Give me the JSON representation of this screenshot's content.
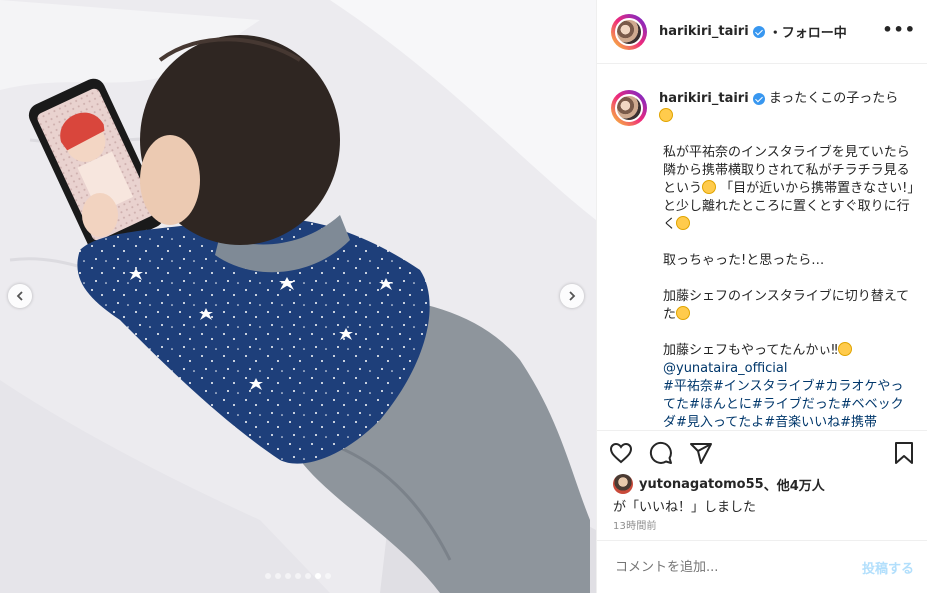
{
  "post": {
    "username": "harikiri_tairi",
    "follow_status": "・フォロー中",
    "more_label": "•••"
  },
  "caption": {
    "username": "harikiri_tairi",
    "first_line": "まったくこの子ったら",
    "paragraphs": [
      "私が平祐奈のインスタライブを見ていたら隣から携帯横取りされて私がチラチラ見るという",
      "「目が近いから携帯置きなさい!」と少し離れたところに置くとすぐ取りに行く",
      "取っちゃった!と思ったら…",
      "加藤シェフのインスタライブに切り替えてた",
      "加藤シェフもやってたんかぃ‼︎"
    ],
    "mention": "@yunataira_official",
    "tags": "#平祐奈#インスタライブ#カラオケやってた#ほんとに#ライブだった#ベベックダ#見入ってたよ#音楽いいね#携帯"
  },
  "likes": {
    "liker": "yutonagatomo55",
    "others": "、他4万人",
    "suffix": "が「いいね！」しました"
  },
  "timestamp": "13時間前",
  "comment": {
    "placeholder": "コメントを追加...",
    "post_label": "投稿する"
  },
  "carousel": {
    "total": 7,
    "active_index": 5
  },
  "colors": {
    "link": "#00376b",
    "verified": "#3897f0",
    "post_disabled": "#b2dffc",
    "muted": "#8e8e8e"
  },
  "icons": [
    "heart-icon",
    "comment-icon",
    "share-icon",
    "bookmark-icon",
    "chevron-left-icon",
    "chevron-right-icon",
    "verified-icon"
  ]
}
